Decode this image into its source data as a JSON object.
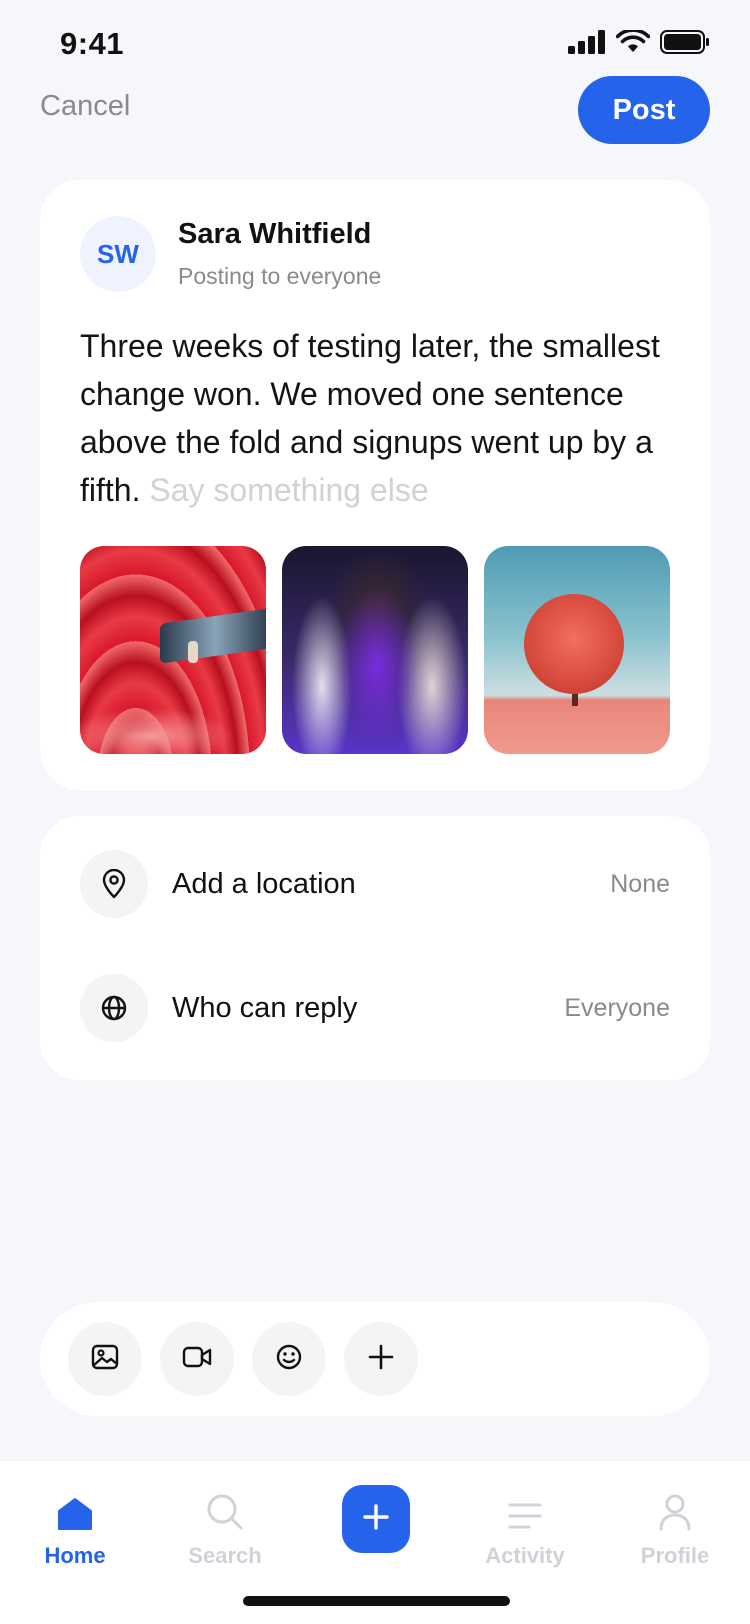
{
  "status_bar": {
    "time": "9:41"
  },
  "header": {
    "cancel_label": "Cancel",
    "post_label": "Post"
  },
  "compose": {
    "avatar_initials": "SW",
    "author_name": "Sara Whitfield",
    "audience": "Posting to everyone",
    "body_text": "Three weeks of testing later, the smallest change won. We moved one sentence above the fold and signups went up by a fifth.",
    "placeholder": "Say something else",
    "images": [
      {
        "name": "red-architecture-photo"
      },
      {
        "name": "dancers-motion-photo"
      },
      {
        "name": "red-tree-field-photo"
      }
    ]
  },
  "options": {
    "location": {
      "label": "Add a location",
      "value": "None",
      "icon": "location-pin-icon"
    },
    "reply": {
      "label": "Who can reply",
      "value": "Everyone",
      "icon": "globe-icon"
    }
  },
  "toolbar": {
    "buttons": [
      "image-icon",
      "video-icon",
      "emoji-icon",
      "plus-icon"
    ]
  },
  "tabbar": {
    "home": "Home",
    "search": "Search",
    "activity": "Activity",
    "profile": "Profile",
    "active": "home"
  },
  "colors": {
    "accent": "#2563eb",
    "background": "#f5f7fa",
    "muted_text": "#8a8a8a",
    "inactive_tab": "#cfd3d8"
  }
}
